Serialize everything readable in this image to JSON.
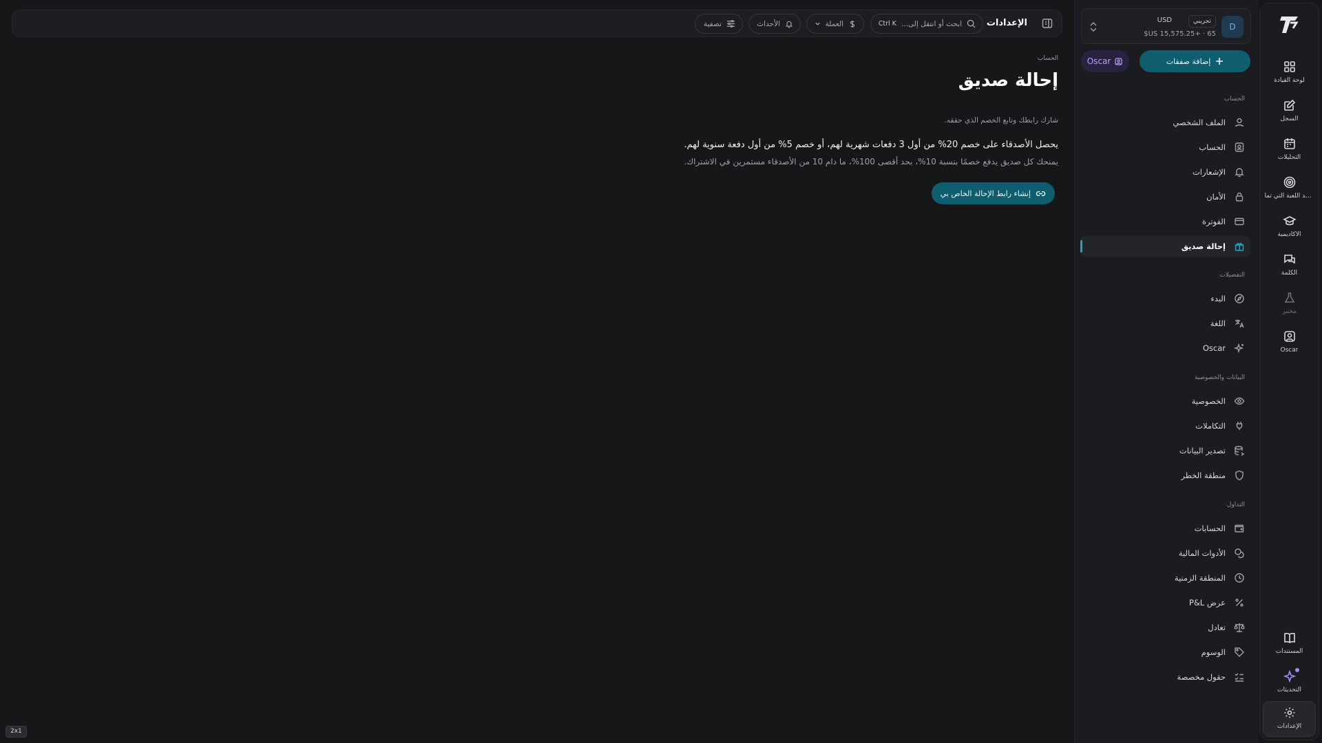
{
  "rail": {
    "items": [
      {
        "label": "لوحة القيادة",
        "icon": "dashboard-icon"
      },
      {
        "label": "السجل",
        "icon": "journal-icon"
      },
      {
        "label": "التحليلات",
        "icon": "calendar-icon"
      },
      {
        "label": "قواعد اللعبة التي تما...",
        "icon": "target-icon"
      },
      {
        "label": "الأكاديمية",
        "icon": "graduation-cap-icon"
      },
      {
        "label": "الكلمة",
        "icon": "chat-icon"
      },
      {
        "label": "مختبر",
        "icon": "flask-icon"
      },
      {
        "label": "Oscar",
        "icon": "oscar-icon"
      }
    ],
    "bottom": [
      {
        "label": "المستندات",
        "icon": "book-icon"
      },
      {
        "label": "التحديثات",
        "icon": "sparkle-icon"
      },
      {
        "label": "الإعدادات",
        "icon": "gear-icon"
      }
    ]
  },
  "account": {
    "avatar": "D",
    "badge": "تجريبي",
    "currency": "USD",
    "balance": "$US 15,575.25+ · 65"
  },
  "panel": {
    "add_trades": "إضافة صفقات",
    "oscar": "Oscar",
    "sections": [
      {
        "title": "الحساب",
        "items": [
          "الملف الشخصي",
          "الحساب",
          "الإشعارات",
          "الأمان",
          "الفوترة",
          "إحالة صديق"
        ]
      },
      {
        "title": "التفضيلات",
        "items": [
          "البدء",
          "اللغة",
          "Oscar"
        ]
      },
      {
        "title": "البيانات والخصوصية",
        "items": [
          "الخصوصية",
          "التكاملات",
          "تصدير البيانات",
          "منطقة الخطر"
        ]
      },
      {
        "title": "التداول",
        "items": [
          "الحسابات",
          "الأدوات المالية",
          "المنطقة الزمنية",
          "عرض P&L",
          "تعادل",
          "الوسوم",
          "حقول مخصصة"
        ]
      }
    ]
  },
  "topbar": {
    "title": "الإعدادات",
    "search_placeholder": "ابحث أو انتقل إلى...",
    "search_shortcut": "Ctrl K",
    "currency": "العملة",
    "events": "الأحداث",
    "filter": "تصفية"
  },
  "main": {
    "breadcrumb": "الحساب",
    "title": "إحالة صديق",
    "subtitle": "شارك رابطك وتابع الخصم الذي حققه.",
    "line1": "يحصل الأصدقاء على خصم 20% من أول 3 دفعات شهرية لهم، أو خصم 5% من أول دفعة سنوية لهم.",
    "line2": "يمنحك كل صديق يدفع خصمًا بنسبة 10%، بحد أقصى 100%، ما دام 10 من الأصدقاء مستمرين في الاشتراك.",
    "cta": "إنشاء رابط الإحالة الخاص بي"
  },
  "ratio_badge": "2x1",
  "colors": {
    "accent": "#0e5e6f",
    "active_bar": "#1fa6c4",
    "oscar": "#b9a5f7"
  }
}
